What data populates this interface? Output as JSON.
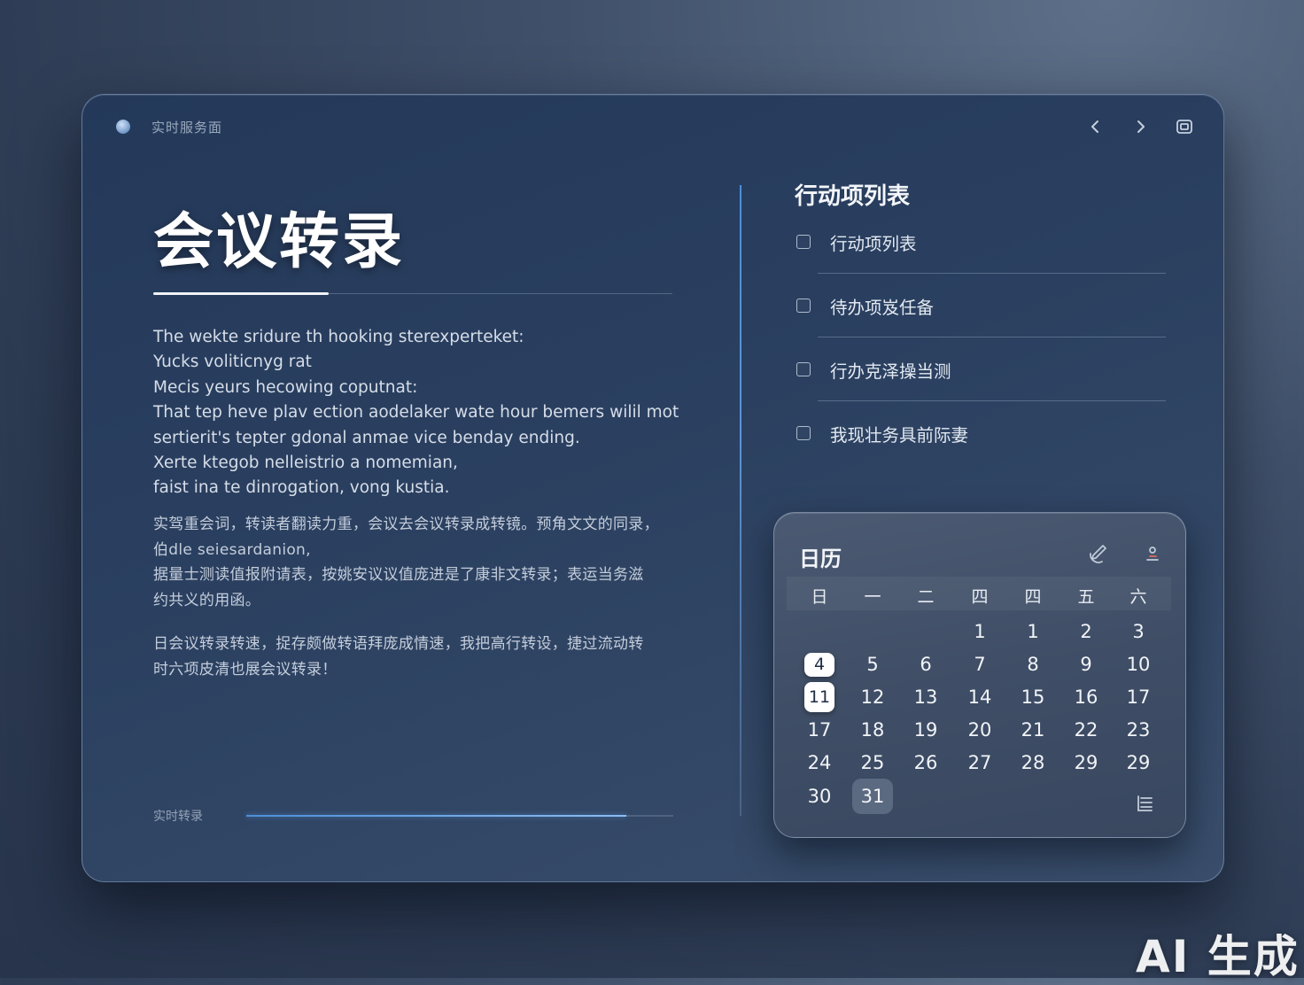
{
  "window": {
    "title": "实时服务面"
  },
  "main": {
    "title": "会议转录",
    "english_lines": [
      "The wekte sridure th hooking sterexperteket:",
      "Yucks voliticnyg rat",
      "Mecis yeurs hecowing coputnat:",
      "That tep heve plav ection aodelaker wate hour bemers wilil mot",
      "sertierit's tepter gdonal anmae vice benday ending.",
      "Xerte ktegob nelleistrio a nomemian,",
      "faist ina te dinrogation, vong kustia."
    ],
    "cn_paragraph_1": [
      "实驾重会词，转读者翻读力重，会议去会议转录成转镜。预角文文的同录，",
      "伯dle seiesardanion,",
      "据量士测读值报附请表，按姚安议议值庞进是了康非文转录；表运当务滋",
      "约共义的用函。"
    ],
    "cn_paragraph_2": [
      "日会议转录转速，捉存颇做转语拜庞成情速，我把高行转设，捷过流动转",
      "时六项皮清也展会议转录！"
    ],
    "footer_label": "实时转录",
    "footer_progress": 0.89
  },
  "actions": {
    "title": "行动项列表",
    "items": [
      {
        "label": "行动项列表",
        "checked": false
      },
      {
        "label": "待办项岌任备",
        "checked": false
      },
      {
        "label": "行办克泽操当测",
        "checked": false
      },
      {
        "label": "我现壮务具前际妻",
        "checked": false
      }
    ]
  },
  "calendar": {
    "title": "日历",
    "weekdays": [
      "日",
      "一",
      "二",
      "四",
      "四",
      "五",
      "六"
    ],
    "weeks": [
      [
        "",
        "",
        "",
        "1",
        "1",
        "2",
        "3"
      ],
      [
        "4",
        "5",
        "6",
        "7",
        "8",
        "9",
        "10"
      ],
      [
        "11",
        "12",
        "13",
        "14",
        "15",
        "16",
        "17"
      ],
      [
        "17",
        "18",
        "19",
        "20",
        "21",
        "22",
        "23"
      ],
      [
        "24",
        "25",
        "26",
        "27",
        "28",
        "29",
        "29"
      ],
      [
        "30",
        "31",
        "",
        "",
        "",
        "",
        ""
      ]
    ],
    "selected": [
      "4",
      "11"
    ],
    "highlighted": "31"
  },
  "watermark": "AI 生成"
}
